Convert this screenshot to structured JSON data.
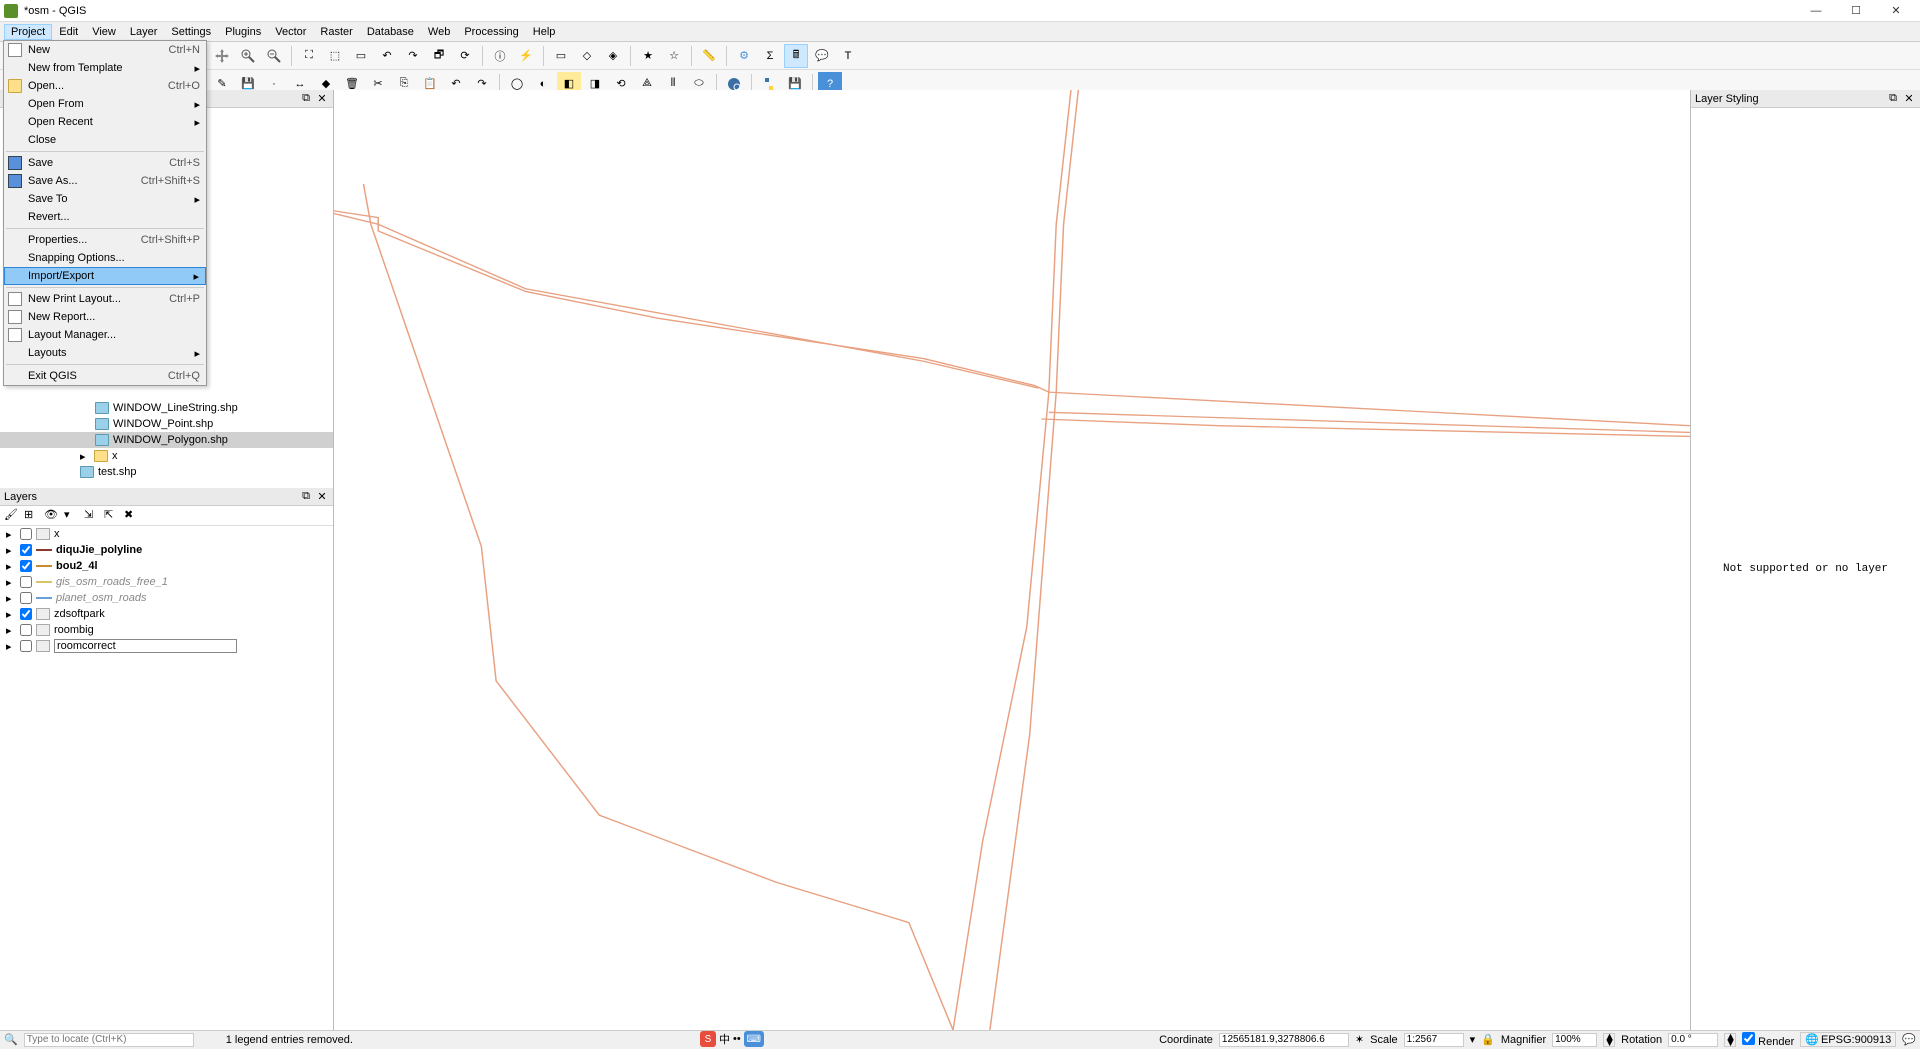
{
  "title": "*osm - QGIS",
  "menubar": [
    "Project",
    "Edit",
    "View",
    "Layer",
    "Settings",
    "Plugins",
    "Vector",
    "Raster",
    "Database",
    "Web",
    "Processing",
    "Help"
  ],
  "project_menu": {
    "groups": [
      [
        {
          "label": "New",
          "shortcut": "Ctrl+N",
          "icon": "file"
        },
        {
          "label": "New from Template",
          "arrow": true
        },
        {
          "label": "Open...",
          "shortcut": "Ctrl+O",
          "icon": "folder"
        },
        {
          "label": "Open From",
          "arrow": true
        },
        {
          "label": "Open Recent",
          "arrow": true
        },
        {
          "label": "Close"
        }
      ],
      [
        {
          "label": "Save",
          "shortcut": "Ctrl+S",
          "icon": "save"
        },
        {
          "label": "Save As...",
          "shortcut": "Ctrl+Shift+S",
          "icon": "saveas"
        },
        {
          "label": "Save To",
          "arrow": true
        },
        {
          "label": "Revert..."
        }
      ],
      [
        {
          "label": "Properties...",
          "shortcut": "Ctrl+Shift+P"
        },
        {
          "label": "Snapping Options..."
        },
        {
          "label": "Import/Export",
          "arrow": true,
          "highlight": true
        }
      ],
      [
        {
          "label": "New Print Layout...",
          "shortcut": "Ctrl+P",
          "icon": "layout"
        },
        {
          "label": "New Report...",
          "icon": "report"
        },
        {
          "label": "Layout Manager...",
          "icon": "layoutmgr"
        },
        {
          "label": "Layouts",
          "arrow": true
        }
      ],
      [
        {
          "label": "Exit QGIS",
          "shortcut": "Ctrl+Q"
        }
      ]
    ]
  },
  "browser_panel": {
    "title": "",
    "items": [
      {
        "label": "WINDOW_LineString.shp",
        "icon": "shp"
      },
      {
        "label": "WINDOW_Point.shp",
        "icon": "shp"
      },
      {
        "label": "WINDOW_Polygon.shp",
        "icon": "shp",
        "hl": true
      },
      {
        "label": "x",
        "icon": "folder",
        "expander": "▸",
        "indent": "indent2"
      },
      {
        "label": "test.shp",
        "icon": "shp",
        "indent": "indent2"
      }
    ]
  },
  "layers_panel": {
    "title": "Layers",
    "layers": [
      {
        "name": "x",
        "checked": false,
        "swatch": "#ccc",
        "type": "group",
        "exp": "▸"
      },
      {
        "name": "diquJie_polyline",
        "checked": true,
        "swatch": "#8b3a2f",
        "bold": true,
        "type": "line"
      },
      {
        "name": "bou2_4l",
        "checked": true,
        "swatch": "#c98b2f",
        "bold": true,
        "type": "line"
      },
      {
        "name": "gis_osm_roads_free_1",
        "checked": false,
        "swatch": "#d9c36a",
        "italic": true,
        "type": "line"
      },
      {
        "name": "planet_osm_roads",
        "checked": false,
        "swatch": "#6aa0d9",
        "italic": true,
        "type": "line"
      },
      {
        "name": "zdsoftpark",
        "checked": true,
        "swatch": "#ccc",
        "type": "group",
        "exp": "▸"
      },
      {
        "name": "roombig",
        "checked": false,
        "swatch": "#ccc",
        "type": "group",
        "exp": "▸"
      },
      {
        "name": "roomcorrect",
        "checked": false,
        "swatch": "#ccc",
        "type": "group",
        "exp": "▸",
        "boxed": true
      }
    ]
  },
  "layer_styling": {
    "title": "Layer Styling",
    "message": "Not supported or no layer"
  },
  "statusbar": {
    "locator_placeholder": "Type to locate (Ctrl+K)",
    "status_text": "1 legend entries removed.",
    "coordinate_label": "Coordinate",
    "coordinate_value": "12565181.9,3278806.6",
    "scale_label": "Scale",
    "scale_value": "1:2567",
    "magnifier_label": "Magnifier",
    "magnifier_value": "100%",
    "rotation_label": "Rotation",
    "rotation_value": "0.0 °",
    "render_label": "Render",
    "crs_label": "EPSG:900913"
  }
}
